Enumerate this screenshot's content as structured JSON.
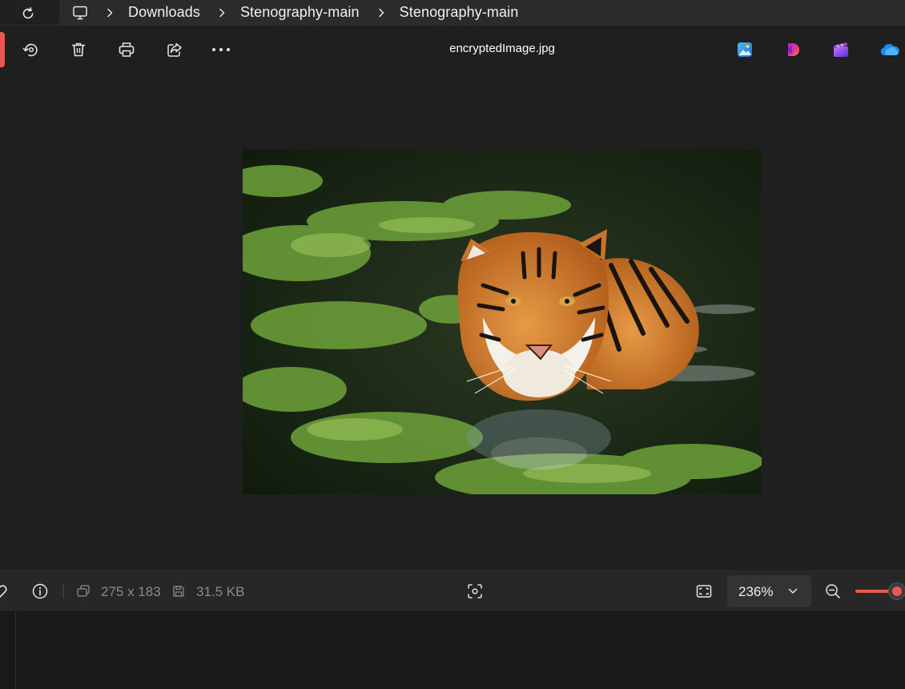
{
  "address_bar": {
    "breadcrumbs": [
      "Downloads",
      "Stenography-main",
      "Stenography-main"
    ]
  },
  "toolbar": {
    "filename": "encryptedImage.jpg",
    "accent_color": "#e8584f"
  },
  "image": {
    "subject": "tiger swimming in green water"
  },
  "status_bar": {
    "dimensions": "275 x 183",
    "file_size": "31.5 KB",
    "zoom_value": "236%",
    "zoom_slider_level": 1.0
  },
  "icons": {
    "refresh": "refresh-icon",
    "computer": "computer-icon",
    "rotate": "rotate-icon",
    "delete": "delete-icon",
    "print": "print-icon",
    "share": "share-icon",
    "more": "more-icon",
    "info": "info-icon",
    "focus": "focus-icon",
    "fit": "fit-to-window-icon",
    "zoom_out": "zoom-out-icon"
  }
}
